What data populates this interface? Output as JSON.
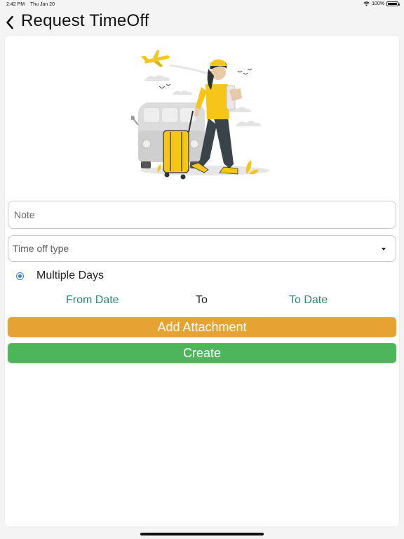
{
  "status_bar": {
    "time": "2:42 PM",
    "date": "Thu Jan 20",
    "battery": "100%",
    "battery_level": 1.0,
    "icons": [
      "wifi-icon",
      "battery-icon"
    ]
  },
  "header": {
    "title": "Request TimeOff",
    "back_icon": "chevron-left-icon"
  },
  "form": {
    "note_placeholder": "Note",
    "note_value": "",
    "time_off_type_placeholder": "Time off type",
    "dropdown_icon": "caret-down-icon",
    "radio_label": "Multiple Days",
    "radio_selected": true,
    "from_date": "From Date",
    "to_label": "To",
    "to_date": "To Date"
  },
  "buttons": {
    "attachment": "Add Attachment",
    "create": "Create"
  },
  "colors": {
    "accent_green": "#4db55a",
    "accent_orange": "#e5a332",
    "date_text": "#2e8b6b",
    "radio": "#2f7fd3",
    "illustration_yellow": "#f5c518",
    "illustration_dark": "#3a4448"
  }
}
